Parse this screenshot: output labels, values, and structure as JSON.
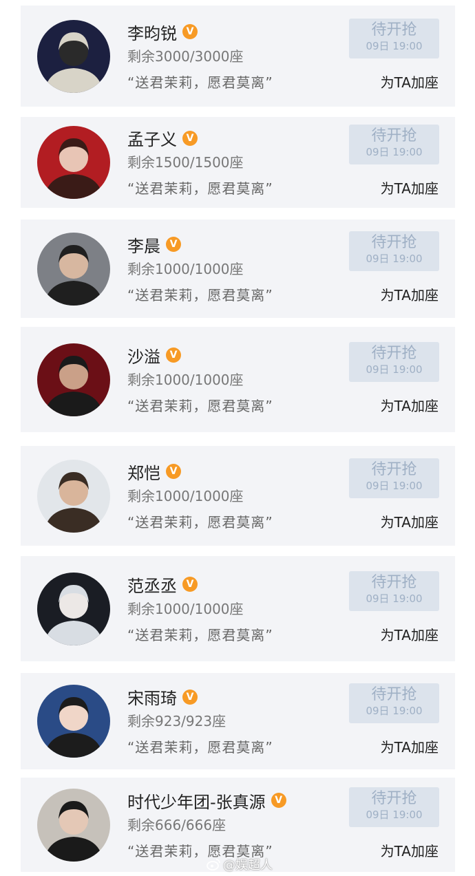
{
  "colors": {
    "card_bg": "#f3f4f7",
    "verified_badge": "#f79a25",
    "button_bg": "#dce3ec",
    "button_text": "#9fb0c5"
  },
  "entries": [
    {
      "name": "李昀锐",
      "seats": "剩余3000/3000座",
      "slogan": "“送君茉莉，愿君莫离”",
      "button_label": "待开抢",
      "button_time": "09日 19:00",
      "add_label": "为TA加座",
      "avatar_icon": "person-avatar"
    },
    {
      "name": "孟子义",
      "seats": "剩余1500/1500座",
      "slogan": "“送君茉莉，愿君莫离”",
      "button_label": "待开抢",
      "button_time": "09日 19:00",
      "add_label": "为TA加座",
      "avatar_icon": "person-avatar"
    },
    {
      "name": "李晨",
      "seats": "剩余1000/1000座",
      "slogan": "“送君茉莉，愿君莫离”",
      "button_label": "待开抢",
      "button_time": "09日 19:00",
      "add_label": "为TA加座",
      "avatar_icon": "person-avatar"
    },
    {
      "name": "沙溢",
      "seats": "剩余1000/1000座",
      "slogan": "“送君茉莉，愿君莫离”",
      "button_label": "待开抢",
      "button_time": "09日 19:00",
      "add_label": "为TA加座",
      "avatar_icon": "person-avatar"
    },
    {
      "name": "郑恺",
      "seats": "剩余1000/1000座",
      "slogan": "“送君茉莉，愿君莫离”",
      "button_label": "待开抢",
      "button_time": "09日 19:00",
      "add_label": "为TA加座",
      "avatar_icon": "person-avatar"
    },
    {
      "name": "范丞丞",
      "seats": "剩余1000/1000座",
      "slogan": "“送君茉莉，愿君莫离”",
      "button_label": "待开抢",
      "button_time": "09日 19:00",
      "add_label": "为TA加座",
      "avatar_icon": "person-avatar"
    },
    {
      "name": "宋雨琦",
      "seats": "剩余923/923座",
      "slogan": "“送君茉莉，愿君莫离”",
      "button_label": "待开抢",
      "button_time": "09日 19:00",
      "add_label": "为TA加座",
      "avatar_icon": "person-avatar"
    },
    {
      "name": "时代少年团-张真源",
      "seats": "剩余666/666座",
      "slogan": "“送君茉莉，愿君莫离”",
      "button_label": "待开抢",
      "button_time": "09日 19:00",
      "add_label": "为TA加座",
      "avatar_icon": "person-avatar"
    }
  ],
  "watermark": {
    "text": "@娱超人",
    "icon": "weibo-icon"
  }
}
